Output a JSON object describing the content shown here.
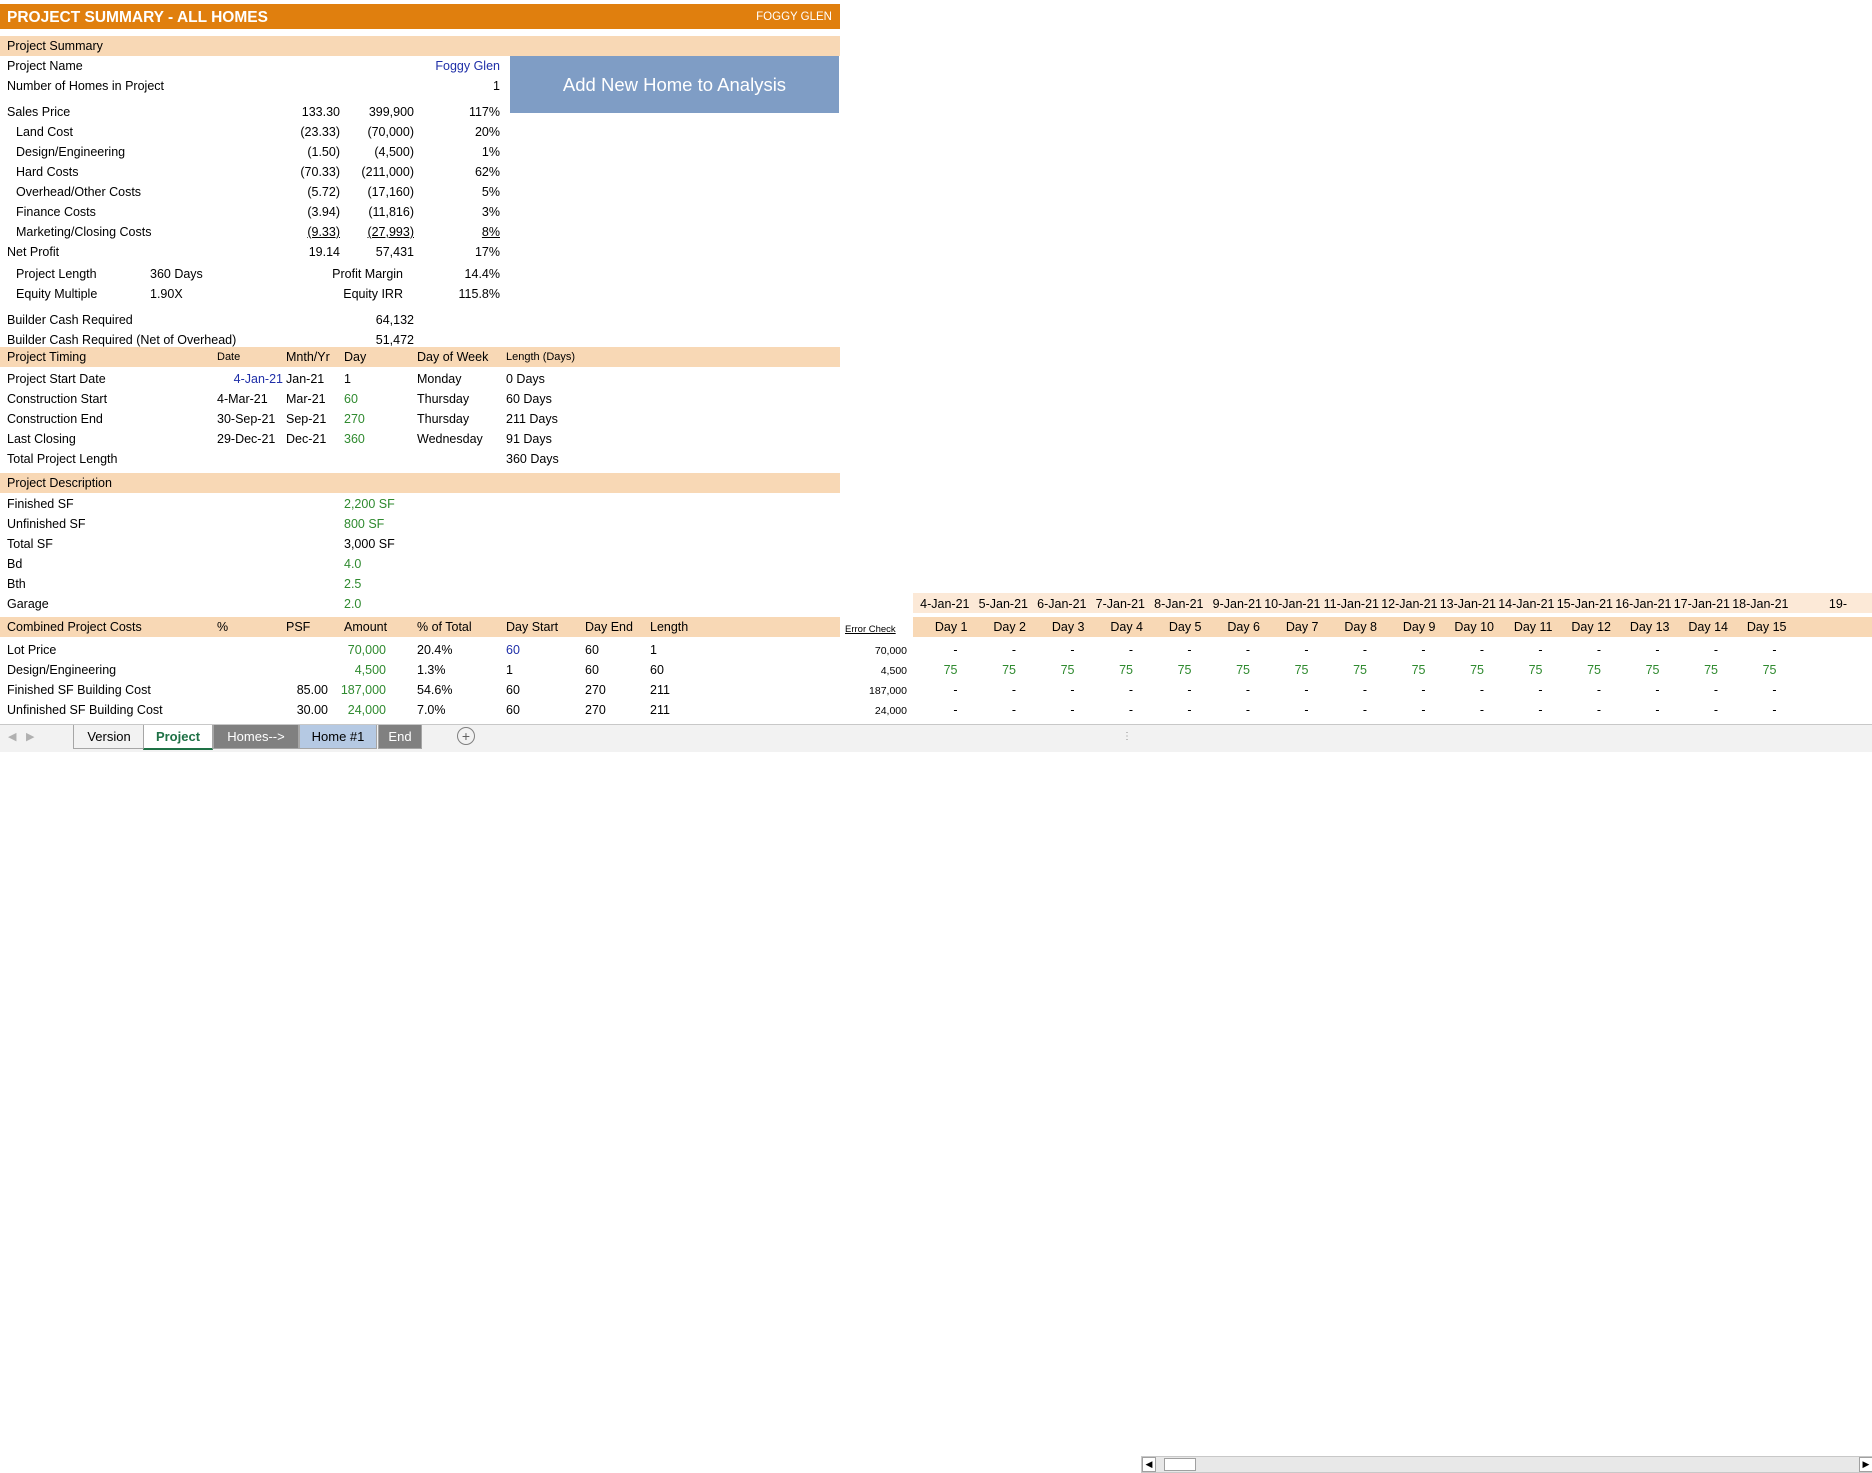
{
  "header": {
    "title": "PROJECT SUMMARY - ALL HOMES",
    "project_tag": "FOGGY GLEN"
  },
  "button": {
    "label": "Add New Home to Analysis"
  },
  "summary": {
    "band": "Project Summary",
    "project_name_label": "Project Name",
    "project_name": "Foggy Glen",
    "homes_label": "Number of Homes in Project",
    "homes": "1",
    "lines": [
      {
        "label": "Sales Price",
        "psf": "133.30",
        "amt": "399,900",
        "pct": "117%"
      },
      {
        "label": "Land Cost",
        "psf": "(23.33)",
        "amt": "(70,000)",
        "pct": "20%"
      },
      {
        "label": "Design/Engineering",
        "psf": "(1.50)",
        "amt": "(4,500)",
        "pct": "1%"
      },
      {
        "label": "Hard Costs",
        "psf": "(70.33)",
        "amt": "(211,000)",
        "pct": "62%"
      },
      {
        "label": "Overhead/Other Costs",
        "psf": "(5.72)",
        "amt": "(17,160)",
        "pct": "5%"
      },
      {
        "label": "Finance Costs",
        "psf": "(3.94)",
        "amt": "(11,816)",
        "pct": "3%"
      },
      {
        "label": "Marketing/Closing Costs",
        "psf": "(9.33)",
        "amt": "(27,993)",
        "pct": "8%"
      },
      {
        "label": "Net Profit",
        "psf": "19.14",
        "amt": "57,431",
        "pct": "17%"
      }
    ],
    "project_length_label": "Project Length",
    "project_length": "360 Days",
    "profit_margin_label": "Profit Margin",
    "profit_margin": "14.4%",
    "equity_multiple_label": "Equity Multiple",
    "equity_multiple": "1.90X",
    "equity_irr_label": "Equity IRR",
    "equity_irr": "115.8%",
    "cash_required_label": "Builder Cash Required",
    "cash_required": "64,132",
    "cash_net_label": "Builder Cash Required (Net of Overhead)",
    "cash_net": "51,472"
  },
  "timing": {
    "band": "Project Timing",
    "headers": {
      "date": "Date",
      "mnth": "Mnth/Yr",
      "day": "Day",
      "dow": "Day of Week",
      "len": "Length (Days)"
    },
    "rows": [
      {
        "label": "Project Start Date",
        "date": "4-Jan-21",
        "mnth": "Jan-21",
        "day": "1",
        "dow": "Monday",
        "len": "0 Days"
      },
      {
        "label": "Construction Start",
        "date": "4-Mar-21",
        "mnth": "Mar-21",
        "day": "60",
        "dow": "Thursday",
        "len": "60 Days"
      },
      {
        "label": "Construction End",
        "date": "30-Sep-21",
        "mnth": "Sep-21",
        "day": "270",
        "dow": "Thursday",
        "len": "211 Days"
      },
      {
        "label": "Last Closing",
        "date": "29-Dec-21",
        "mnth": "Dec-21",
        "day": "360",
        "dow": "Wednesday",
        "len": "91 Days"
      }
    ],
    "total_label": "Total Project Length",
    "total": "360 Days"
  },
  "description": {
    "band": "Project Description",
    "rows": [
      {
        "label": "Finished SF",
        "value": "2,200 SF"
      },
      {
        "label": "Unfinished SF",
        "value": "800 SF"
      },
      {
        "label": "Total SF",
        "value": "3,000 SF"
      },
      {
        "label": "Bd",
        "value": "4.0"
      },
      {
        "label": "Bth",
        "value": "2.5"
      },
      {
        "label": "Garage",
        "value": "2.0"
      }
    ]
  },
  "costs": {
    "band": "Combined Project Costs",
    "headers": {
      "pct": "%",
      "psf": "PSF",
      "amount": "Amount",
      "total": "% of Total",
      "start": "Day Start",
      "end": "Day End",
      "length": "Length"
    },
    "error_check": "Error Check",
    "rows": [
      {
        "label": "Lot Price",
        "psf": "",
        "amount": "70,000",
        "total": "20.4%",
        "start": "60",
        "end": "60",
        "length": "1",
        "check": "70,000",
        "cells": [
          "-",
          "-",
          "-",
          "-",
          "-",
          "-",
          "-",
          "-",
          "-",
          "-",
          "-",
          "-",
          "-",
          "-",
          "-"
        ]
      },
      {
        "label": "Design/Engineering",
        "psf": "",
        "amount": "4,500",
        "total": "1.3%",
        "start": "1",
        "end": "60",
        "length": "60",
        "check": "4,500",
        "cells": [
          "75",
          "75",
          "75",
          "75",
          "75",
          "75",
          "75",
          "75",
          "75",
          "75",
          "75",
          "75",
          "75",
          "75",
          "75"
        ]
      },
      {
        "label": "Finished SF Building Cost",
        "psf": "85.00",
        "amount": "187,000",
        "total": "54.6%",
        "start": "60",
        "end": "270",
        "length": "211",
        "check": "187,000",
        "cells": [
          "-",
          "-",
          "-",
          "-",
          "-",
          "-",
          "-",
          "-",
          "-",
          "-",
          "-",
          "-",
          "-",
          "-",
          "-"
        ]
      },
      {
        "label": "Unfinished SF Building Cost",
        "psf": "30.00",
        "amount": "24,000",
        "total": "7.0%",
        "start": "60",
        "end": "270",
        "length": "211",
        "check": "24,000",
        "cells": [
          "-",
          "-",
          "-",
          "-",
          "-",
          "-",
          "-",
          "-",
          "-",
          "-",
          "-",
          "-",
          "-",
          "-",
          "-"
        ]
      }
    ]
  },
  "timeline": {
    "dates": [
      "4-Jan-21",
      "5-Jan-21",
      "6-Jan-21",
      "7-Jan-21",
      "8-Jan-21",
      "9-Jan-21",
      "10-Jan-21",
      "11-Jan-21",
      "12-Jan-21",
      "13-Jan-21",
      "14-Jan-21",
      "15-Jan-21",
      "16-Jan-21",
      "17-Jan-21",
      "18-Jan-21",
      "19-"
    ],
    "days": [
      "Day 1",
      "Day 2",
      "Day 3",
      "Day 4",
      "Day 5",
      "Day 6",
      "Day 7",
      "Day 8",
      "Day 9",
      "Day 10",
      "Day 11",
      "Day 12",
      "Day 13",
      "Day 14",
      "Day 15"
    ]
  },
  "tabs": [
    "Version",
    "Project",
    "Homes-->",
    "Home #1",
    "End"
  ],
  "colors": {
    "title": "#e07f0e",
    "band": "#f8d8b5",
    "button": "#7f9dc5",
    "input_blue": "#1f2fa8",
    "input_green": "#2f8a2f"
  }
}
